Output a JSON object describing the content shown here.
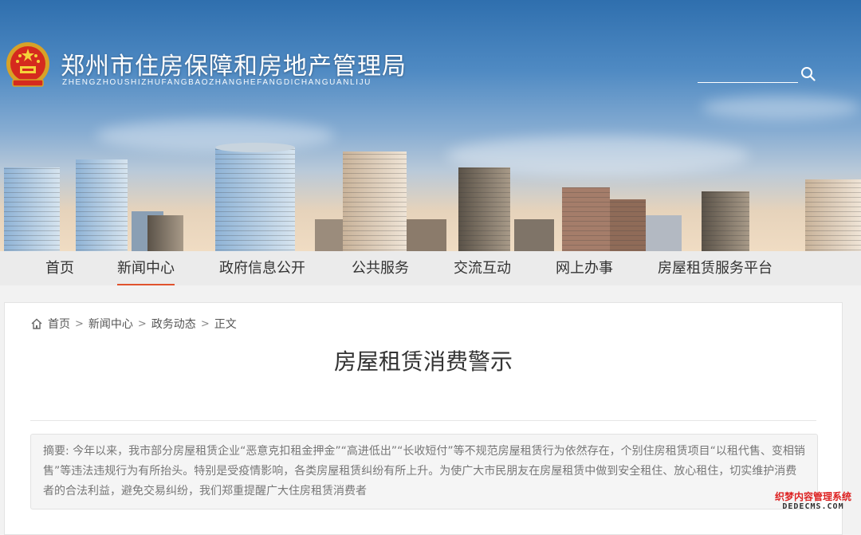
{
  "header": {
    "title": "郑州市住房保障和房地产管理局",
    "subtitle": "ZHENGZHOUSHIZHUFANGBAOZHANGHEFANGDICHANGUANLIJU",
    "emblem_icon": "national-emblem-icon",
    "search": {
      "value": "",
      "placeholder": "",
      "icon": "search-icon"
    }
  },
  "nav": {
    "items": [
      {
        "label": "首页"
      },
      {
        "label": "新闻中心",
        "active": true
      },
      {
        "label": "政府信息公开"
      },
      {
        "label": "公共服务"
      },
      {
        "label": "交流互动"
      },
      {
        "label": "网上办事"
      },
      {
        "label": "房屋租赁服务平台"
      }
    ]
  },
  "breadcrumb": {
    "icon": "home-icon",
    "items": [
      "首页",
      "新闻中心",
      "政务动态",
      "正文"
    ]
  },
  "article": {
    "title": "房屋租赁消费警示",
    "summary_label": "摘要:",
    "summary_text": " 今年以来，我市部分房屋租赁企业“恶意克扣租金押金”“高进低出”“长收短付”等不规范房屋租赁行为依然存在，个别住房租赁项目“以租代售、变相销售”等违法违规行为有所抬头。特别是受疫情影响，各类房屋租赁纠纷有所上升。为使广大市民朋友在房屋租赁中做到安全租住、放心租住，切实维护消费者的合法利益，避免交易纠纷，我们郑重提醒广大住房租赁消费者"
  },
  "watermark": {
    "line1": "织梦内容管理系统",
    "line2": "DEDECMS.COM"
  },
  "colors": {
    "nav_active_underline": "#e0522e",
    "nav_bg": "#ebebeb",
    "page_bg": "#f2f2f2",
    "summary_bg": "#f5f5f5",
    "watermark_red": "#dd2222"
  }
}
